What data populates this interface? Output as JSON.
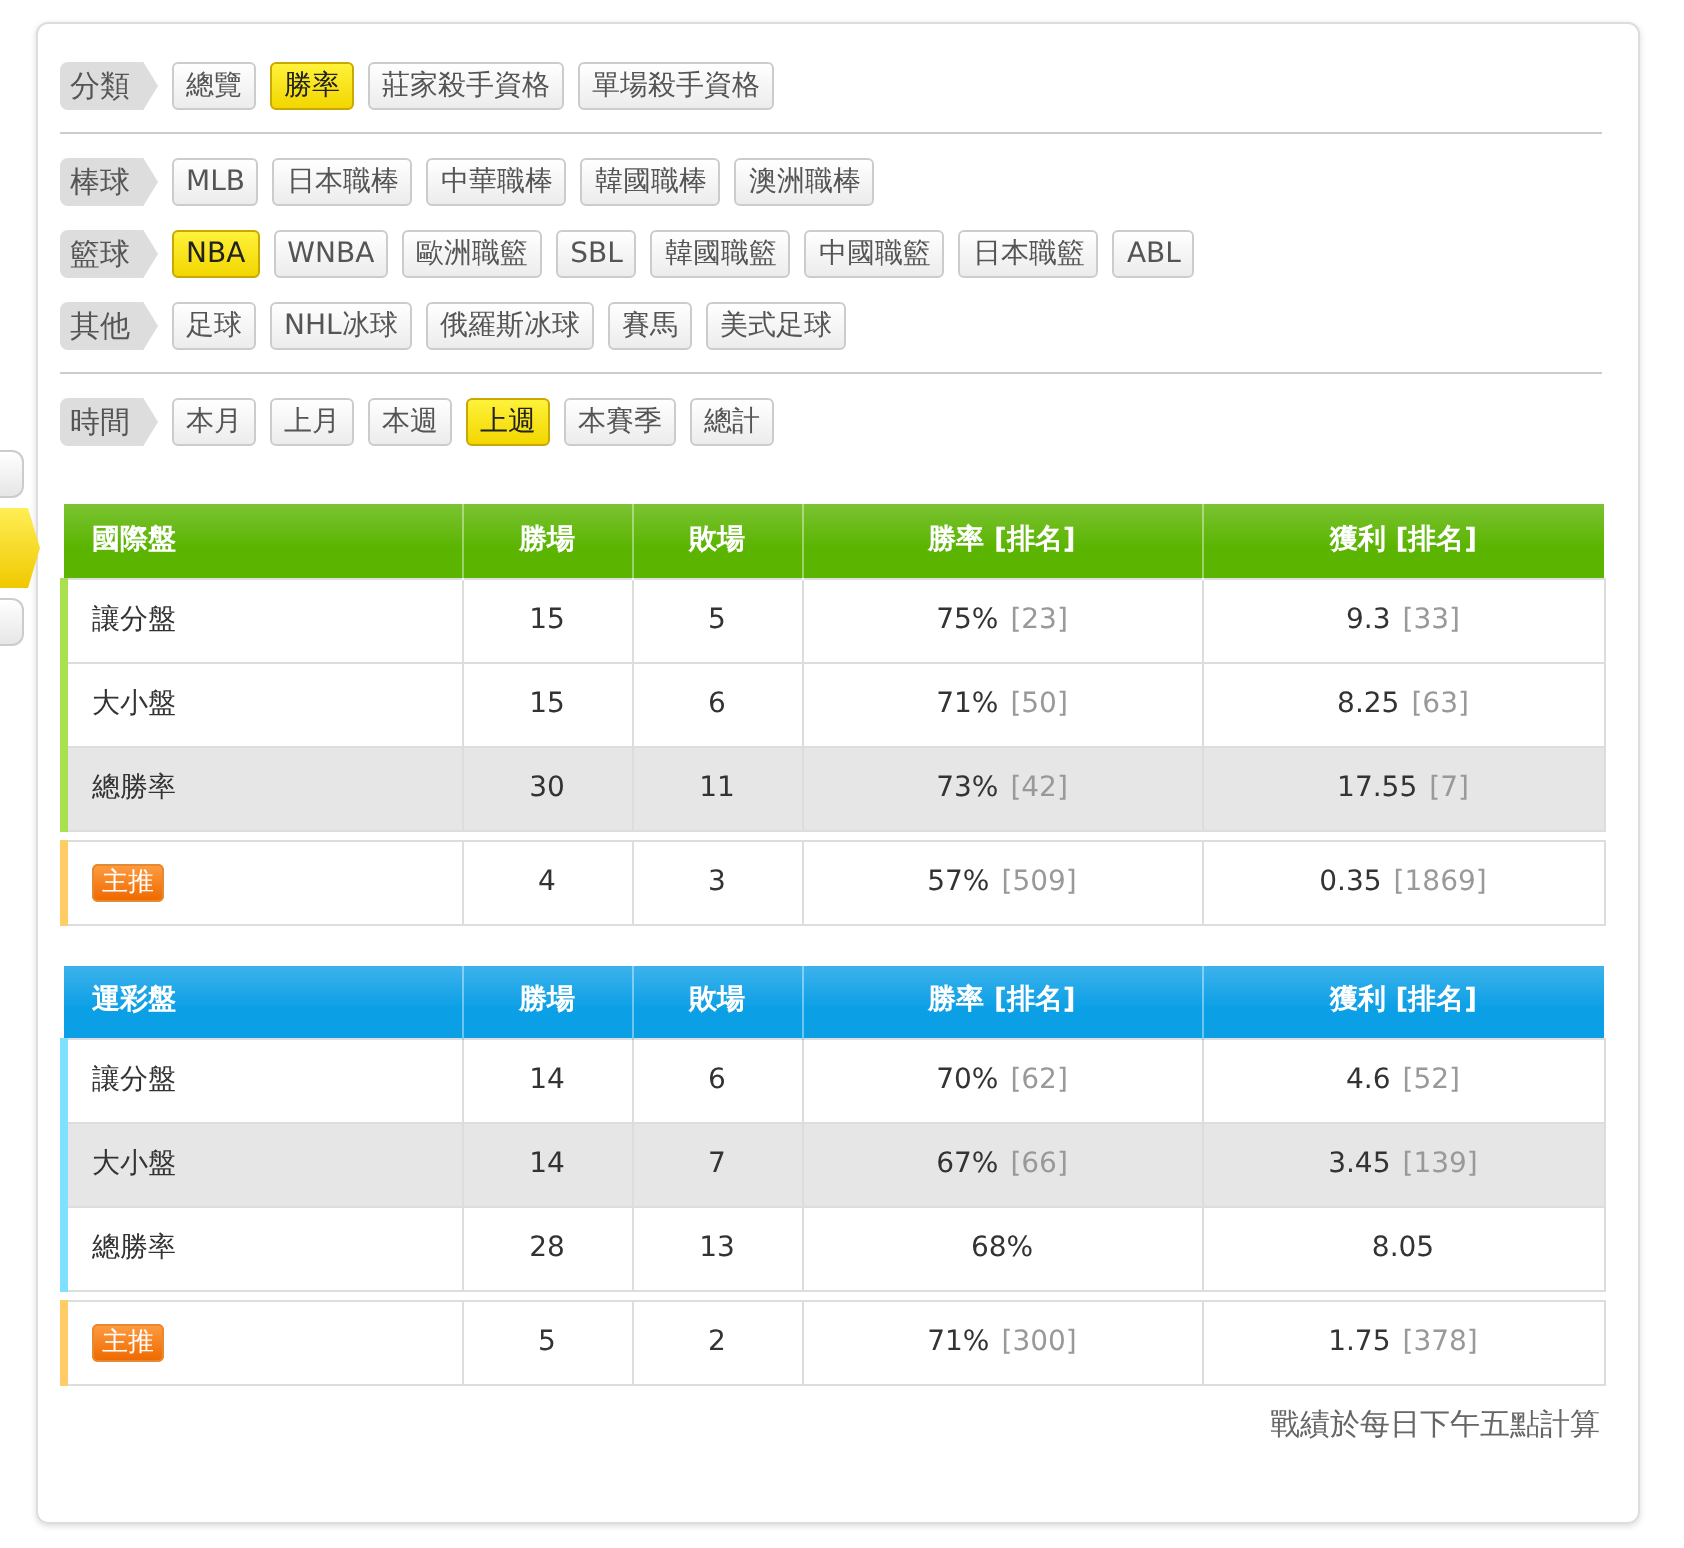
{
  "side_tabs": [
    {
      "selected": false
    },
    {
      "selected": true
    },
    {
      "selected": false
    }
  ],
  "filter_sections": [
    {
      "groups": [
        {
          "label": "分類",
          "options": [
            {
              "label": "總覽",
              "selected": false
            },
            {
              "label": "勝率",
              "selected": true
            },
            {
              "label": "莊家殺手資格",
              "selected": false
            },
            {
              "label": "單場殺手資格",
              "selected": false
            }
          ]
        }
      ]
    },
    {
      "groups": [
        {
          "label": "棒球",
          "options": [
            {
              "label": "MLB",
              "selected": false
            },
            {
              "label": "日本職棒",
              "selected": false
            },
            {
              "label": "中華職棒",
              "selected": false
            },
            {
              "label": "韓國職棒",
              "selected": false
            },
            {
              "label": "澳洲職棒",
              "selected": false
            }
          ]
        },
        {
          "label": "籃球",
          "options": [
            {
              "label": "NBA",
              "selected": true
            },
            {
              "label": "WNBA",
              "selected": false
            },
            {
              "label": "歐洲職籃",
              "selected": false
            },
            {
              "label": "SBL",
              "selected": false
            },
            {
              "label": "韓國職籃",
              "selected": false
            },
            {
              "label": "中國職籃",
              "selected": false
            },
            {
              "label": "日本職籃",
              "selected": false
            },
            {
              "label": "ABL",
              "selected": false
            }
          ]
        },
        {
          "label": "其他",
          "options": [
            {
              "label": "足球",
              "selected": false
            },
            {
              "label": "NHL冰球",
              "selected": false
            },
            {
              "label": "俄羅斯冰球",
              "selected": false
            },
            {
              "label": "賽馬",
              "selected": false
            },
            {
              "label": "美式足球",
              "selected": false
            }
          ]
        }
      ]
    },
    {
      "groups": [
        {
          "label": "時間",
          "options": [
            {
              "label": "本月",
              "selected": false
            },
            {
              "label": "上月",
              "selected": false
            },
            {
              "label": "本週",
              "selected": false
            },
            {
              "label": "上週",
              "selected": true
            },
            {
              "label": "本賽季",
              "selected": false
            },
            {
              "label": "總計",
              "selected": false
            }
          ]
        }
      ]
    }
  ],
  "tables": [
    {
      "color": "#5ab400",
      "columns": [
        "國際盤",
        "勝場",
        "敗場",
        "勝率 [排名]",
        "獲利 [排名]"
      ],
      "rows": [
        {
          "kind": "plain",
          "label": "讓分盤",
          "wins": "15",
          "losses": "5",
          "rate": "75%",
          "rate_rank": "[23]",
          "profit": "9.3",
          "profit_rank": "[33]",
          "highlighted": false
        },
        {
          "kind": "plain",
          "label": "大小盤",
          "wins": "15",
          "losses": "6",
          "rate": "71%",
          "rate_rank": "[50]",
          "profit": "8.25",
          "profit_rank": "[63]",
          "highlighted": false
        },
        {
          "kind": "plain",
          "label": "總勝率",
          "wins": "30",
          "losses": "11",
          "rate": "73%",
          "rate_rank": "[42]",
          "profit": "17.55",
          "profit_rank": "[7]",
          "highlighted": true
        },
        {
          "kind": "featured",
          "label": "主推",
          "wins": "4",
          "losses": "3",
          "rate": "57%",
          "rate_rank": "[509]",
          "profit": "0.35",
          "profit_rank": "[1869]",
          "highlighted": false
        }
      ]
    },
    {
      "color": "#0b9fe6",
      "columns": [
        "運彩盤",
        "勝場",
        "敗場",
        "勝率 [排名]",
        "獲利 [排名]"
      ],
      "rows": [
        {
          "kind": "plain",
          "label": "讓分盤",
          "wins": "14",
          "losses": "6",
          "rate": "70%",
          "rate_rank": "[62]",
          "profit": "4.6",
          "profit_rank": "[52]",
          "highlighted": false
        },
        {
          "kind": "plain",
          "label": "大小盤",
          "wins": "14",
          "losses": "7",
          "rate": "67%",
          "rate_rank": "[66]",
          "profit": "3.45",
          "profit_rank": "[139]",
          "highlighted": true
        },
        {
          "kind": "plain",
          "label": "總勝率",
          "wins": "28",
          "losses": "13",
          "rate": "68%",
          "profit": "8.05",
          "highlighted": false
        },
        {
          "kind": "featured",
          "label": "主推",
          "wins": "5",
          "losses": "2",
          "rate": "71%",
          "rate_rank": "[300]",
          "profit": "1.75",
          "profit_rank": "[378]",
          "highlighted": false
        }
      ]
    }
  ],
  "footnote": "戰績於每日下午五點計算"
}
